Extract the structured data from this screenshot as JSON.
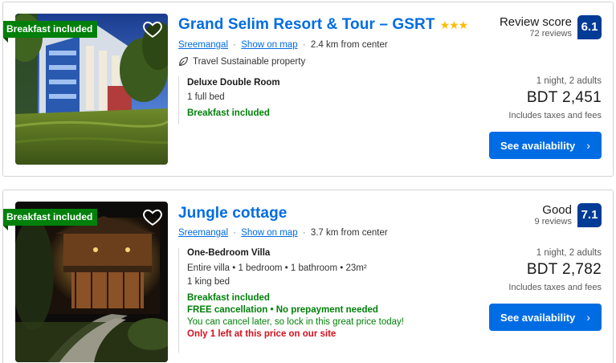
{
  "listings": [
    {
      "badge": "Breakfast included",
      "name": "Grand Selim Resort & Tour – GSRT",
      "stars": "★★★",
      "location": "Sreemangal",
      "show_on_map": "Show on map",
      "distance": "2.4 km from center",
      "sustainable": "Travel Sustainable property",
      "room_name": "Deluxe Double Room",
      "room_details": [
        "1 full bed"
      ],
      "breakfast": "Breakfast included",
      "review_label": "Review score",
      "review_count": "72 reviews",
      "score": "6.1",
      "nights": "1 night, 2 adults",
      "price": "BDT 2,451",
      "taxes": "Includes taxes and fees",
      "button": "See availability",
      "button_icon": "chevron-right-icon"
    },
    {
      "badge": "Breakfast included",
      "name": "Jungle cottage",
      "location": "Sreemangal",
      "show_on_map": "Show on map",
      "distance": "3.7 km from center",
      "room_name": "One-Bedroom Villa",
      "room_details": [
        "Entire villa • 1 bedroom • 1 bathroom • 23m²",
        "1 king bed"
      ],
      "breakfast": "Breakfast included",
      "free_cancellation": "FREE cancellation • No prepayment needed",
      "cancel_note": "You can cancel later, so lock in this great price today!",
      "scarcity": "Only 1 left at this price on our site",
      "review_label": "Good",
      "review_count": "9 reviews",
      "score": "7.1",
      "nights": "1 night, 2 adults",
      "price": "BDT 2,782",
      "taxes": "Includes taxes and fees",
      "button": "See availability",
      "button_icon": "chevron-right-icon"
    }
  ],
  "colors": {
    "link": "#006ce4",
    "badge_green": "#00800a",
    "score_blue": "#003b95",
    "star_yellow": "#febb02",
    "warning_red": "#d4111e"
  }
}
